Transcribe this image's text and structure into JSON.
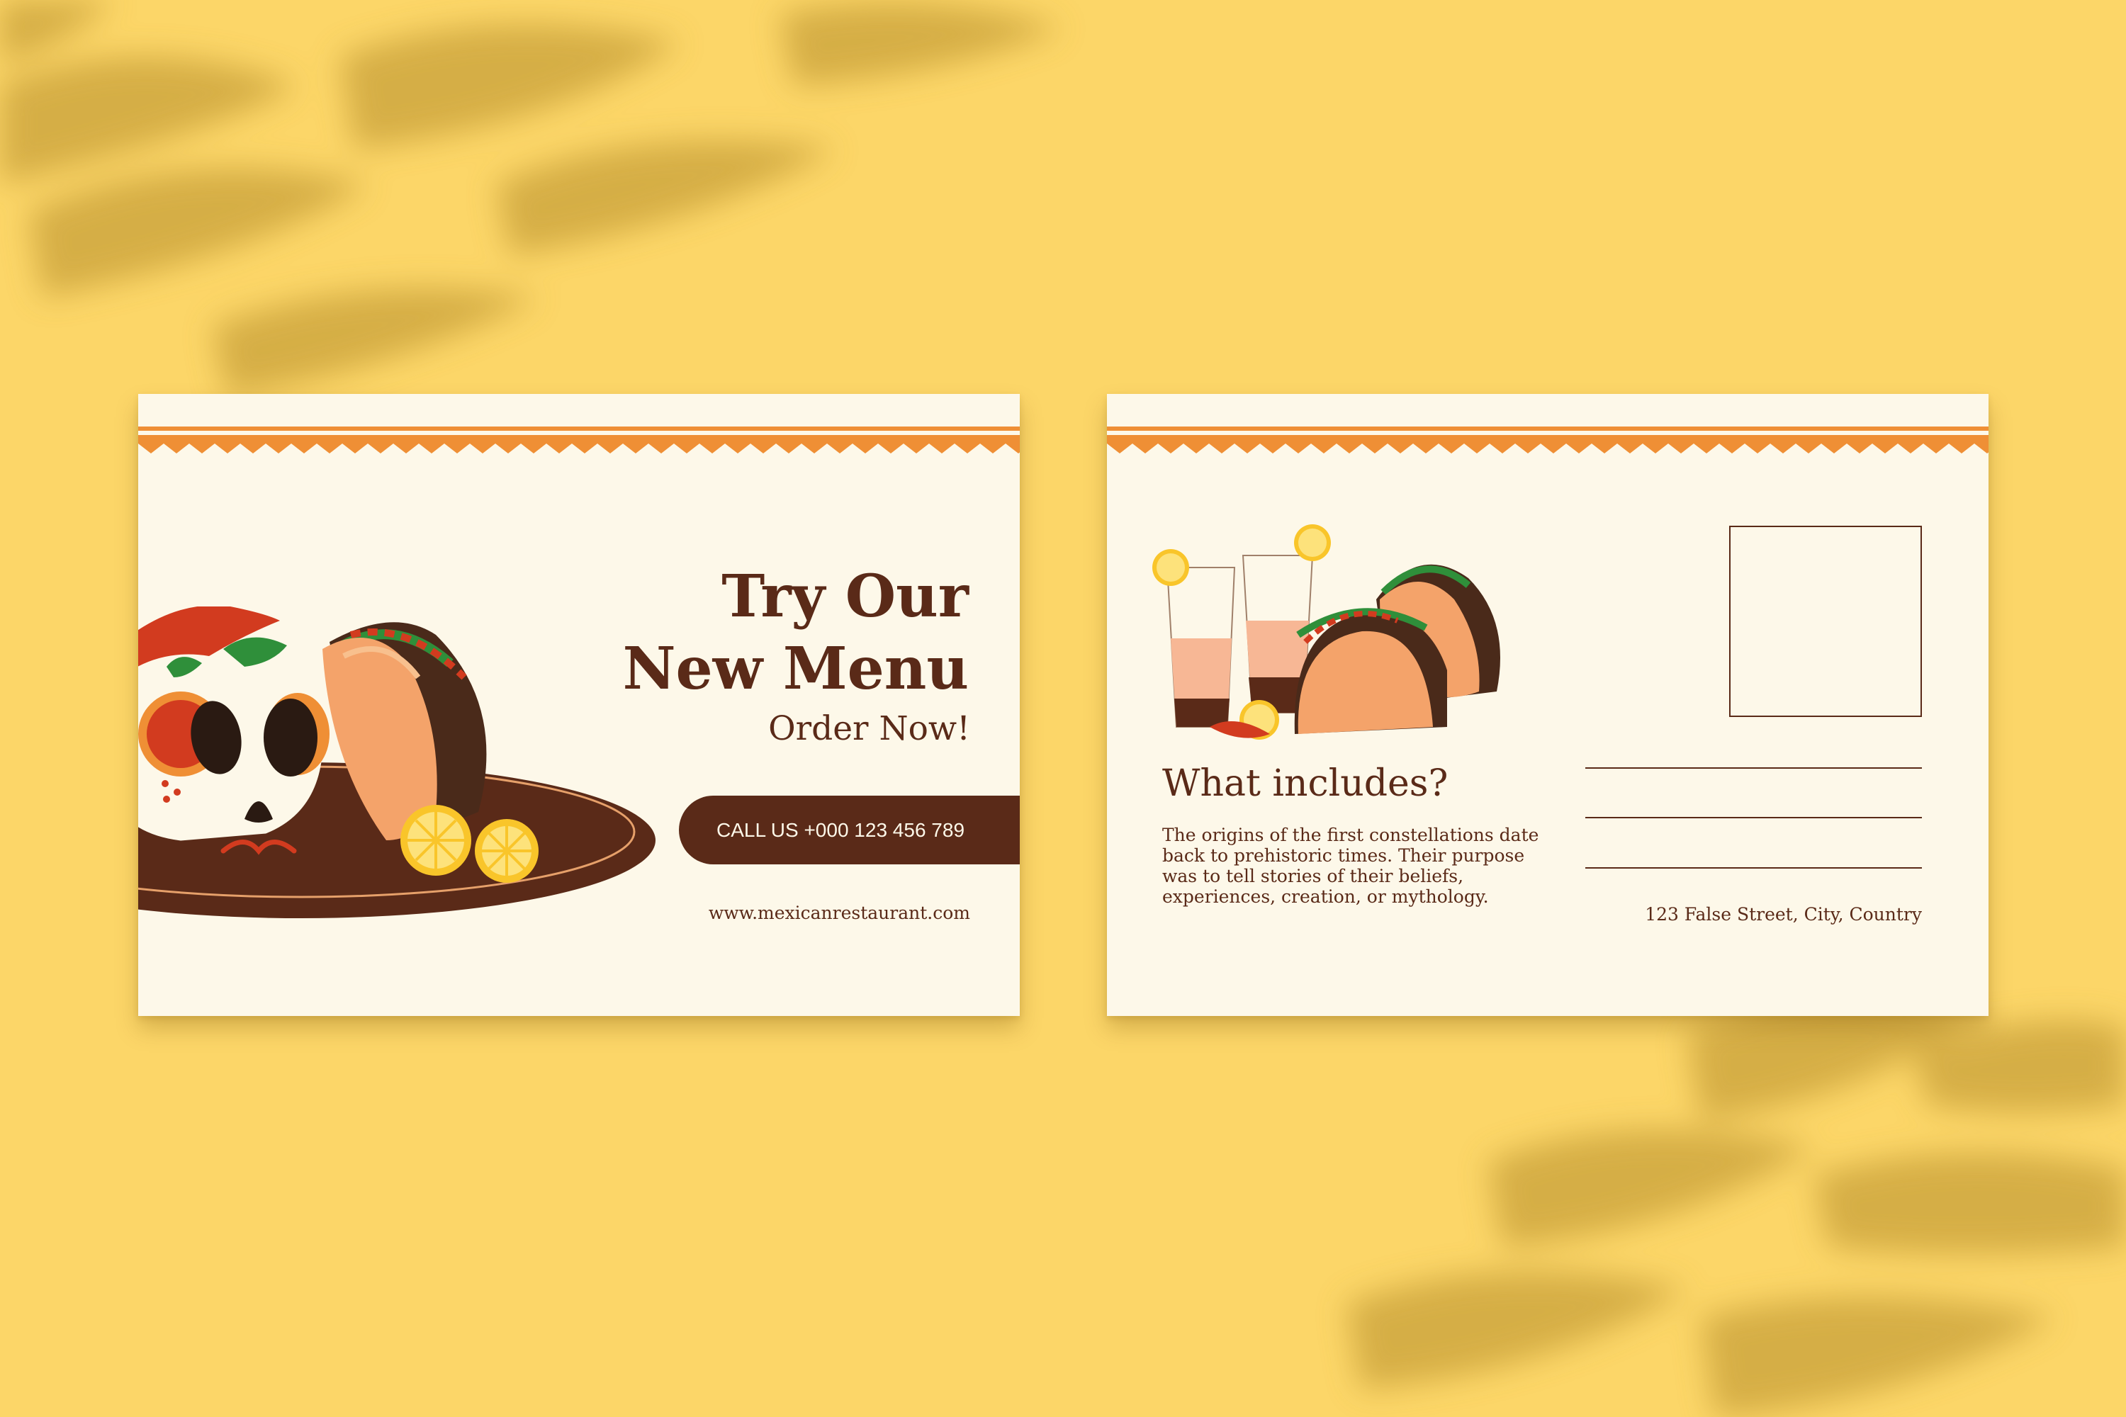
{
  "colors": {
    "background": "#fcd668",
    "card": "#fdf8e9",
    "brown": "#5a2a18",
    "orange": "#ef8f35",
    "red": "#d23b1f",
    "taco_shell": "#f4a36a",
    "lemon": "#f9c52a",
    "leaf": "#2f8f3a"
  },
  "front": {
    "title_line1": "Try Our",
    "title_line2": "New Menu",
    "subtitle": "Order Now!",
    "call_button": "CALL US +000 123 456 789",
    "website": "www.mexicanrestaurant.com"
  },
  "back": {
    "heading": "What includes?",
    "body": "The origins of the first constellations date back to prehistoric times. Their purpose was to tell stories of their beliefs, experiences, creation, or mythology.",
    "address": "123 False Street, City, Country"
  },
  "icons": [
    "sugar-skull-icon",
    "taco-icon",
    "lemon-slice-icon",
    "glass-icon",
    "chili-pepper-icon",
    "leaf-shadow"
  ]
}
